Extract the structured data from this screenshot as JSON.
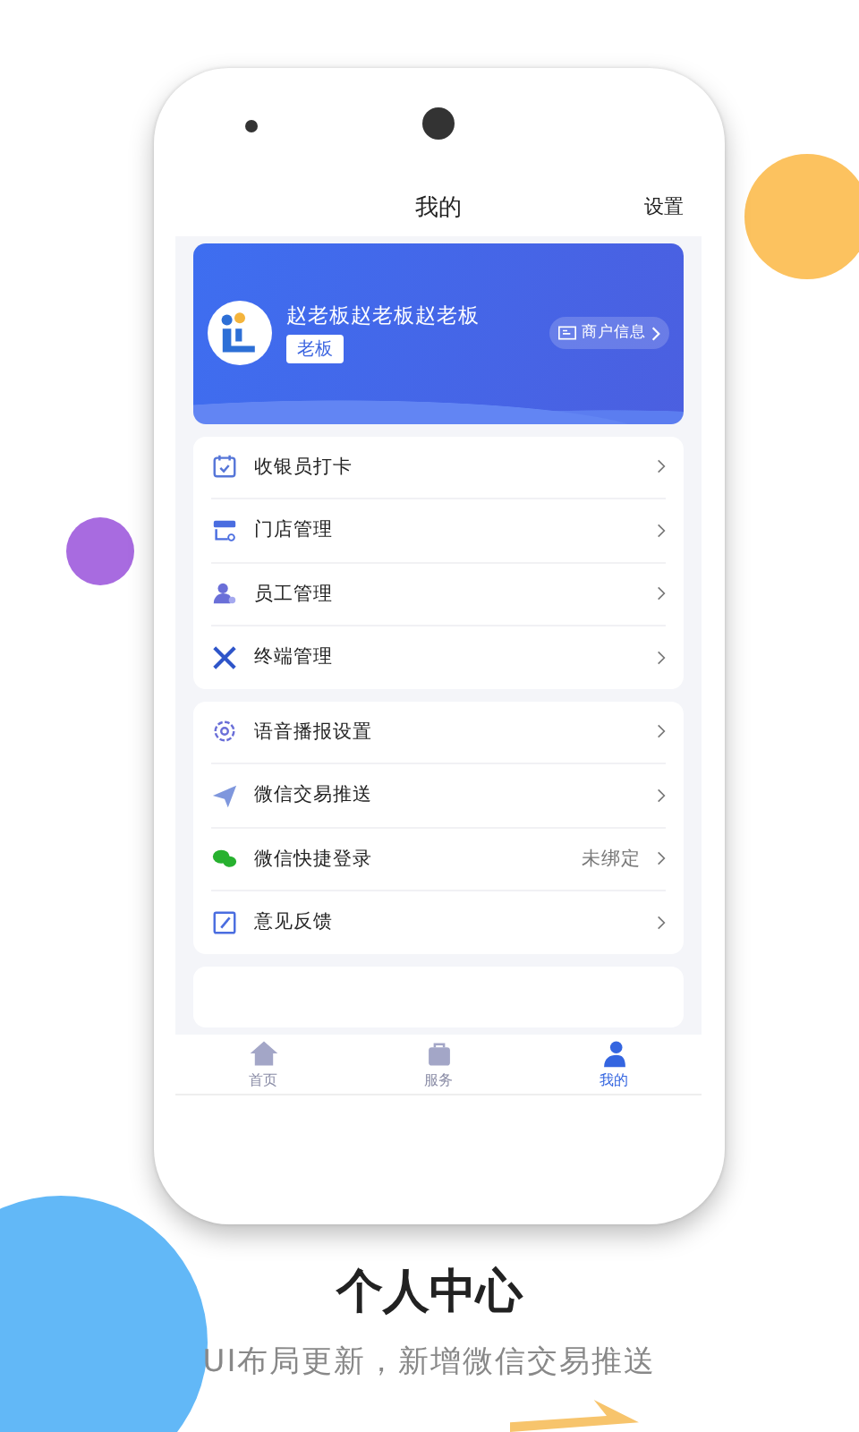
{
  "header": {
    "title": "我的",
    "action": "设置"
  },
  "profile": {
    "name": "赵老板赵老板赵老板",
    "role": "老板",
    "link": "商户信息"
  },
  "menu_groups": [
    [
      {
        "kind": "checkin",
        "label": "收银员打卡"
      },
      {
        "kind": "store",
        "label": "门店管理"
      },
      {
        "kind": "staff",
        "label": "员工管理"
      },
      {
        "kind": "tools",
        "label": "终端管理"
      }
    ],
    [
      {
        "kind": "gear",
        "label": "语音播报设置"
      },
      {
        "kind": "plane",
        "label": "微信交易推送"
      },
      {
        "kind": "chat",
        "label": "微信快捷登录",
        "value": "未绑定"
      },
      {
        "kind": "edit",
        "label": "意见反馈"
      }
    ]
  ],
  "tabs": [
    {
      "kind": "home",
      "label": "首页",
      "selected": false
    },
    {
      "kind": "bag",
      "label": "服务",
      "selected": false
    },
    {
      "kind": "person",
      "label": "我的",
      "selected": true
    }
  ],
  "headline": "个人中心",
  "subtitle": "UI布局更新，新增微信交易推送"
}
